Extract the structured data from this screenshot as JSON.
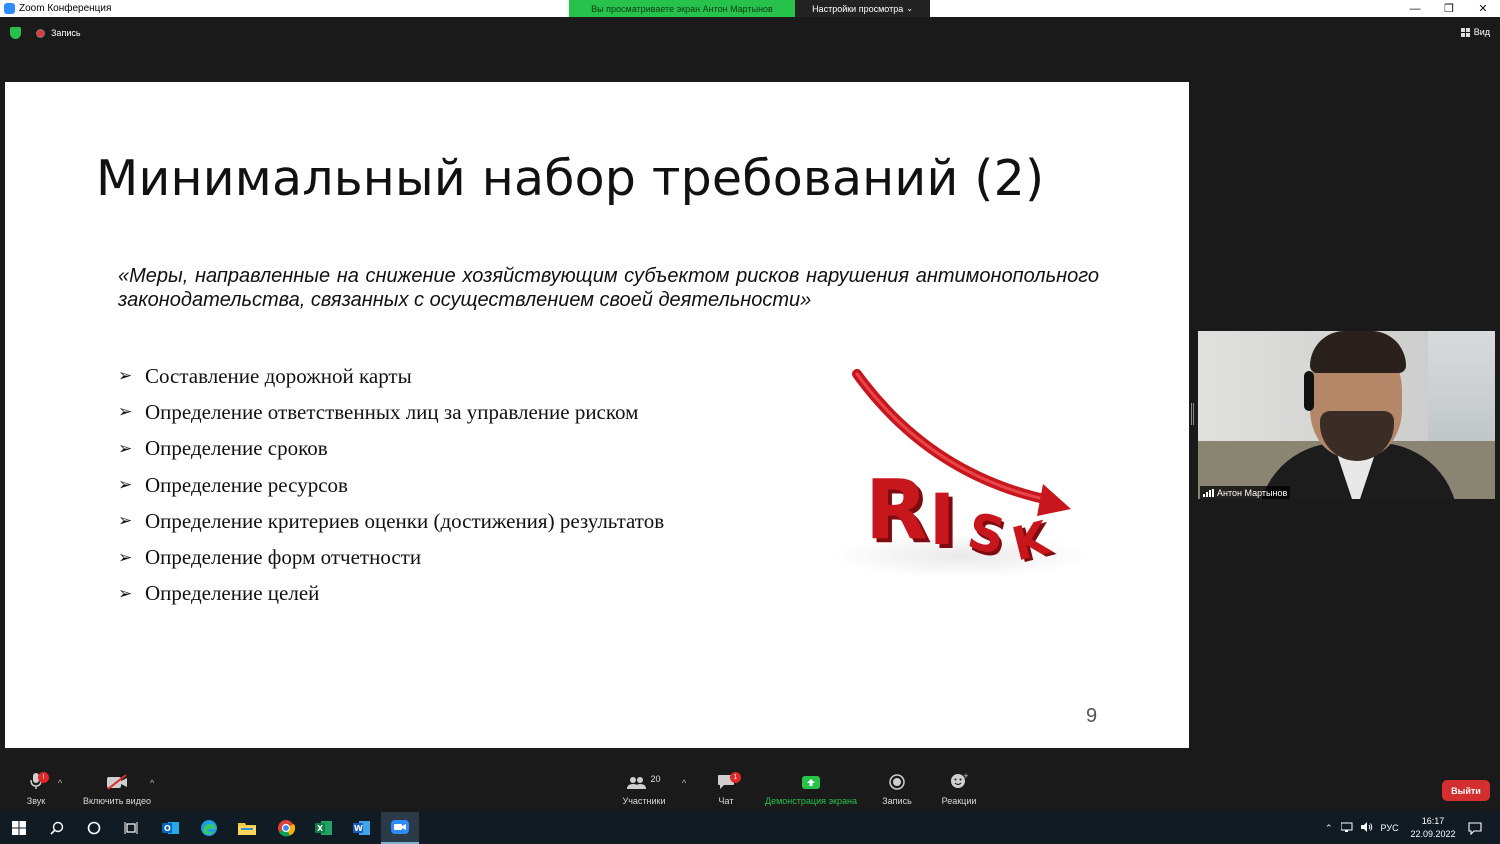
{
  "window": {
    "title": "Zoom Конференция",
    "sharing_banner": "Вы просматриваете экран Антон Мартынов",
    "view_settings": "Настройки просмотра",
    "minimize": "—",
    "restore": "❐",
    "close": "✕"
  },
  "meeting_top": {
    "recording_label": "Запись",
    "view_label": "Вид"
  },
  "slide": {
    "title": "Минимальный набор требований (2)",
    "quote": "«Меры, направленные на снижение хозяйствующим субъектом рисков нарушения антимонопольного законодательства, связанных с осуществлением своей деятельности»",
    "bullet_marker": "➢",
    "bullets": [
      "Составление дорожной карты",
      "Определение ответственных лиц за управление риском",
      "Определение сроков",
      "Определение ресурсов",
      "Определение критериев оценки (достижения) результатов",
      "Определение форм отчетности",
      "Определение целей"
    ],
    "page_number": "9",
    "image_text": "RISK"
  },
  "participant": {
    "name": "Антон Мартынов"
  },
  "toolbar": {
    "audio_label": "Звук",
    "video_label": "Включить видео",
    "participants_label": "Участники",
    "participants_count": "20",
    "chat_label": "Чат",
    "chat_badge": "1",
    "audio_badge": "!",
    "share_label": "Демонстрация экрана",
    "record_label": "Запись",
    "reactions_label": "Реакции",
    "leave_label": "Выйти",
    "caret": "^"
  },
  "taskbar": {
    "apps": [
      "windows-start",
      "search",
      "cortana",
      "task-view",
      "outlook",
      "edge",
      "file-explorer",
      "chrome",
      "excel",
      "word",
      "zoom"
    ],
    "language": "РУС",
    "time": "16:17",
    "date": "22.09.2022"
  },
  "colors": {
    "zoom_green": "#27c24c",
    "leave_red": "#d32f2f",
    "zoom_blue": "#2d8cff",
    "risk_red": "#c8161d"
  }
}
